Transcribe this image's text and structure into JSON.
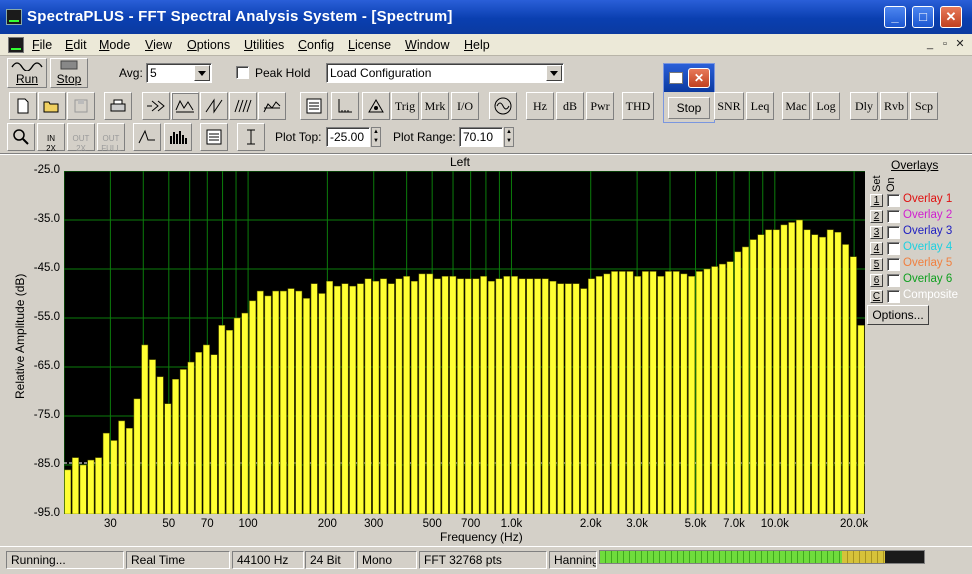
{
  "window": {
    "title": "SpectraPLUS - FFT Spectral Analysis System - [Spectrum]"
  },
  "menu": [
    "File",
    "Edit",
    "Mode",
    "View",
    "Options",
    "Utilities",
    "Config",
    "License",
    "Window",
    "Help"
  ],
  "toolbar1": {
    "run_label": "Run",
    "stop_label": "Stop",
    "avg_label": "Avg:",
    "avg_value": "5",
    "peak_hold_label": "Peak Hold",
    "config_value": "Load Configuration"
  },
  "toolbar2": [
    "Trig",
    "Mrk",
    "I/O",
    "Hz",
    "dB",
    "Pwr",
    "THD",
    "SNR",
    "Leq",
    "Mac",
    "Log",
    "Dly",
    "Rvb",
    "Scp"
  ],
  "toolbar3": {
    "plot_top_label": "Plot Top:",
    "plot_top_value": "-25.00",
    "plot_range_label": "Plot Range:",
    "plot_range_value": "70.10"
  },
  "float_window": {
    "stop_label": "Stop"
  },
  "overlays": {
    "title": "Overlays",
    "col_set": "Set",
    "col_on": "On",
    "items": [
      {
        "num": "1",
        "name": "Overlay 1",
        "color": "#e01010"
      },
      {
        "num": "2",
        "name": "Overlay 2",
        "color": "#d020d0"
      },
      {
        "num": "3",
        "name": "Overlay 3",
        "color": "#2020c0"
      },
      {
        "num": "4",
        "name": "Overlay 4",
        "color": "#20d0e0"
      },
      {
        "num": "5",
        "name": "Overlay 5",
        "color": "#f08040"
      },
      {
        "num": "6",
        "name": "Overlay 6",
        "color": "#10a020"
      },
      {
        "num": "C",
        "name": "Composite",
        "color": "#ffffff"
      }
    ],
    "options_label": "Options..."
  },
  "status": {
    "state": "Running...",
    "mode": "Real Time",
    "rate": "44100 Hz",
    "bits": "24 Bit",
    "channels": "Mono",
    "fft": "FFT 32768 pts",
    "window": "Hanning",
    "level_meter": 0.88
  },
  "chart_data": {
    "type": "bar",
    "title": "Left",
    "xlabel": "Frequency (Hz)",
    "ylabel": "Relative Amplitude (dB)",
    "x_scale": "log",
    "xlim": [
      20,
      22000
    ],
    "ylim": [
      -95,
      -25
    ],
    "y_ticks": [
      "-25.0",
      "-35.0",
      "-45.0",
      "-55.0",
      "-65.0",
      "-75.0",
      "-85.0",
      "-95.0"
    ],
    "x_ticks": [
      {
        "v": 30,
        "t": "30"
      },
      {
        "v": 50,
        "t": "50"
      },
      {
        "v": 70,
        "t": "70"
      },
      {
        "v": 100,
        "t": "100"
      },
      {
        "v": 200,
        "t": "200"
      },
      {
        "v": 300,
        "t": "300"
      },
      {
        "v": 500,
        "t": "500"
      },
      {
        "v": 700,
        "t": "700"
      },
      {
        "v": 1000,
        "t": "1.0k"
      },
      {
        "v": 2000,
        "t": "2.0k"
      },
      {
        "v": 3000,
        "t": "3.0k"
      },
      {
        "v": 5000,
        "t": "5.0k"
      },
      {
        "v": 7000,
        "t": "7.0k"
      },
      {
        "v": 10000,
        "t": "10.0k"
      },
      {
        "v": 20000,
        "t": "20.0k"
      }
    ],
    "grid": true,
    "bar_color": "#ffff33",
    "values": [
      -86,
      -83.5,
      -85,
      -84,
      -83.5,
      -78.5,
      -80,
      -76,
      -77.5,
      -71.5,
      -60.5,
      -63.5,
      -67,
      -72.5,
      -67.5,
      -65.5,
      -64,
      -62,
      -60.5,
      -62.5,
      -56.5,
      -57.5,
      -55,
      -54,
      -51.5,
      -49.5,
      -50.5,
      -49.5,
      -49.5,
      -49,
      -49.5,
      -51,
      -48,
      -50,
      -47.5,
      -48.5,
      -48,
      -48.5,
      -48,
      -47,
      -47.5,
      -47,
      -48,
      -47,
      -46.5,
      -47.5,
      -46,
      -46,
      -47,
      -46.5,
      -46.5,
      -47,
      -47,
      -47,
      -46.5,
      -47.5,
      -47,
      -46.5,
      -46.5,
      -47,
      -47,
      -47,
      -47,
      -47.5,
      -48,
      -48,
      -48,
      -49,
      -47,
      -46.5,
      -46,
      -45.5,
      -45.5,
      -45.5,
      -46.5,
      -45.5,
      -45.5,
      -46.5,
      -45.5,
      -45.5,
      -46,
      -46.5,
      -45.5,
      -45,
      -44.5,
      -44,
      -43.5,
      -41.5,
      -40.5,
      -39,
      -38,
      -37,
      -37,
      -36,
      -35.5,
      -35,
      -37,
      -38,
      -38.5,
      -37,
      -37.5,
      -40,
      -42.5,
      -56.5
    ]
  }
}
